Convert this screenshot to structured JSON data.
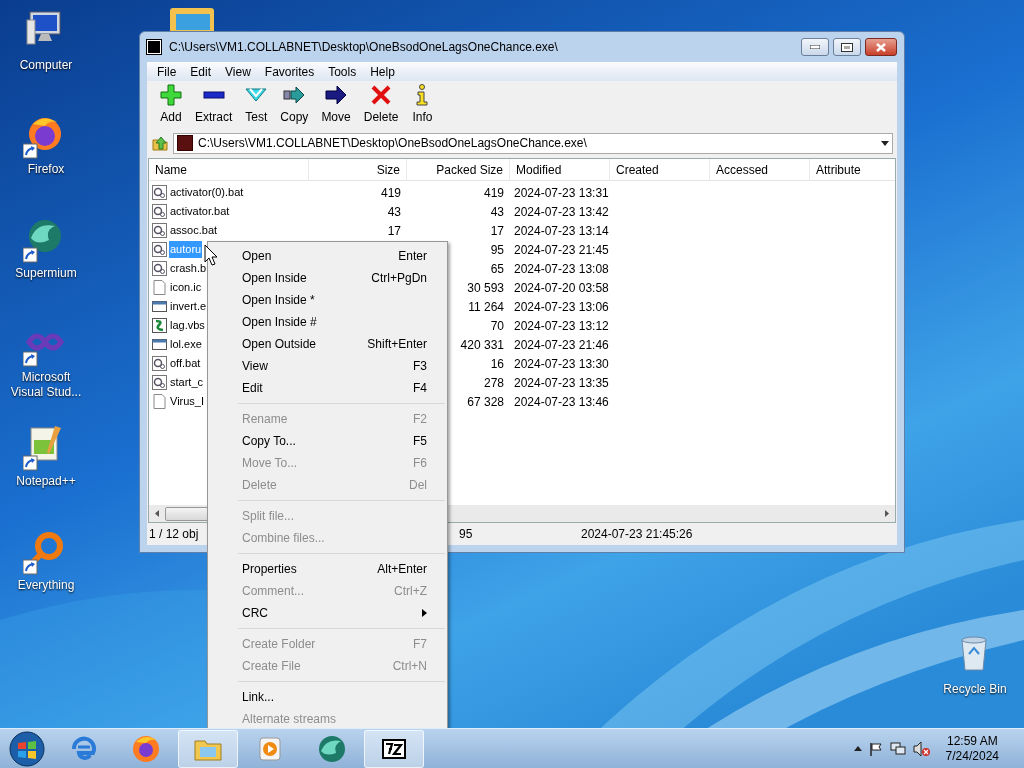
{
  "desktop_icons": [
    {
      "label": "Computer",
      "kind": "computer",
      "shortcut": false
    },
    {
      "label": "Firefox",
      "kind": "firefox",
      "shortcut": true
    },
    {
      "label": "Supermium",
      "kind": "supermium",
      "shortcut": true
    },
    {
      "label": "Microsoft Visual Stud...",
      "kind": "vs",
      "shortcut": true
    },
    {
      "label": "Notepad++",
      "kind": "notepad",
      "shortcut": true
    },
    {
      "label": "Everything",
      "kind": "everything",
      "shortcut": true
    },
    {
      "label": "Recycle Bin",
      "kind": "recycle",
      "shortcut": false
    }
  ],
  "window": {
    "title": "C:\\Users\\VM1.COLLABNET\\Desktop\\OneBsodOneLagsOneChance.exe\\",
    "menu": [
      "File",
      "Edit",
      "View",
      "Favorites",
      "Tools",
      "Help"
    ],
    "toolbar": [
      {
        "label": "Add",
        "kind": "add"
      },
      {
        "label": "Extract",
        "kind": "extract"
      },
      {
        "label": "Test",
        "kind": "test"
      },
      {
        "label": "Copy",
        "kind": "copy"
      },
      {
        "label": "Move",
        "kind": "move"
      },
      {
        "label": "Delete",
        "kind": "delete"
      },
      {
        "label": "Info",
        "kind": "info"
      }
    ],
    "address": "C:\\Users\\VM1.COLLABNET\\Desktop\\OneBsodOneLagsOneChance.exe\\",
    "columns": [
      "Name",
      "Size",
      "Packed Size",
      "Modified",
      "Created",
      "Accessed",
      "Attribute"
    ],
    "rows": [
      {
        "name": "activator(0).bat",
        "kind": "bat",
        "size": "419",
        "packed": "419",
        "modified": "2024-07-23 13:31",
        "selected": false
      },
      {
        "name": "activator.bat",
        "kind": "bat",
        "size": "43",
        "packed": "43",
        "modified": "2024-07-23 13:42",
        "selected": false
      },
      {
        "name": "assoc.bat",
        "kind": "bat",
        "size": "17",
        "packed": "17",
        "modified": "2024-07-23 13:14",
        "selected": false
      },
      {
        "name": "autoru",
        "kind": "bat",
        "packed": "95",
        "modified": "2024-07-23 21:45",
        "selected": true
      },
      {
        "name": "crash.b",
        "kind": "bat",
        "packed": "65",
        "modified": "2024-07-23 13:08",
        "selected": false
      },
      {
        "name": "icon.ic",
        "kind": "blank",
        "packed": "30 593",
        "modified": "2024-07-20 03:58",
        "selected": false
      },
      {
        "name": "invert.e",
        "kind": "exe",
        "packed": "11 264",
        "modified": "2024-07-23 13:06",
        "selected": false
      },
      {
        "name": "lag.vbs",
        "kind": "script",
        "packed": "70",
        "modified": "2024-07-23 13:12",
        "selected": false
      },
      {
        "name": "lol.exe",
        "kind": "exe",
        "packed": "420 331",
        "modified": "2024-07-23 21:46",
        "selected": false
      },
      {
        "name": "off.bat",
        "kind": "bat",
        "packed": "16",
        "modified": "2024-07-23 13:30",
        "selected": false
      },
      {
        "name": "start_c",
        "kind": "bat",
        "packed": "278",
        "modified": "2024-07-23 13:35",
        "selected": false
      },
      {
        "name": "Virus_I",
        "kind": "blank",
        "packed": "67 328",
        "modified": "2024-07-23 13:46",
        "selected": false
      }
    ],
    "status": [
      "1 / 12 obj",
      "95",
      "2024-07-23 21:45:26"
    ]
  },
  "context_menu": [
    {
      "kind": "item",
      "label": "Open",
      "shortcut": "Enter",
      "disabled": false
    },
    {
      "kind": "item",
      "label": "Open Inside",
      "shortcut": "Ctrl+PgDn",
      "disabled": false
    },
    {
      "kind": "item",
      "label": "Open Inside *",
      "disabled": false
    },
    {
      "kind": "item",
      "label": "Open Inside #",
      "disabled": false
    },
    {
      "kind": "item",
      "label": "Open Outside",
      "shortcut": "Shift+Enter",
      "disabled": false
    },
    {
      "kind": "item",
      "label": "View",
      "shortcut": "F3",
      "disabled": false
    },
    {
      "kind": "item",
      "label": "Edit",
      "shortcut": "F4",
      "disabled": false
    },
    {
      "kind": "separator"
    },
    {
      "kind": "item",
      "label": "Rename",
      "shortcut": "F2",
      "disabled": true
    },
    {
      "kind": "item",
      "label": "Copy To...",
      "shortcut": "F5",
      "disabled": false
    },
    {
      "kind": "item",
      "label": "Move To...",
      "shortcut": "F6",
      "disabled": true
    },
    {
      "kind": "item",
      "label": "Delete",
      "shortcut": "Del",
      "disabled": true
    },
    {
      "kind": "separator"
    },
    {
      "kind": "item",
      "label": "Split file...",
      "disabled": true
    },
    {
      "kind": "item",
      "label": "Combine files...",
      "disabled": true
    },
    {
      "kind": "separator"
    },
    {
      "kind": "item",
      "label": "Properties",
      "shortcut": "Alt+Enter",
      "disabled": false
    },
    {
      "kind": "item",
      "label": "Comment...",
      "shortcut": "Ctrl+Z",
      "disabled": true
    },
    {
      "kind": "submenu",
      "label": "CRC",
      "disabled": false
    },
    {
      "kind": "separator"
    },
    {
      "kind": "item",
      "label": "Create Folder",
      "shortcut": "F7",
      "disabled": true
    },
    {
      "kind": "item",
      "label": "Create File",
      "shortcut": "Ctrl+N",
      "disabled": true
    },
    {
      "kind": "separator"
    },
    {
      "kind": "item",
      "label": "Link...",
      "disabled": false
    },
    {
      "kind": "item",
      "label": "Alternate streams",
      "disabled": true
    }
  ],
  "taskbar": [
    {
      "kind": "ie",
      "active": false
    },
    {
      "kind": "firefox",
      "active": false
    },
    {
      "kind": "explorer",
      "active": true
    },
    {
      "kind": "media",
      "active": false
    },
    {
      "kind": "supermium",
      "active": false
    },
    {
      "kind": "sevenzip",
      "active": true
    }
  ],
  "clock": {
    "time": "12:59 AM",
    "date": "7/24/2024"
  }
}
